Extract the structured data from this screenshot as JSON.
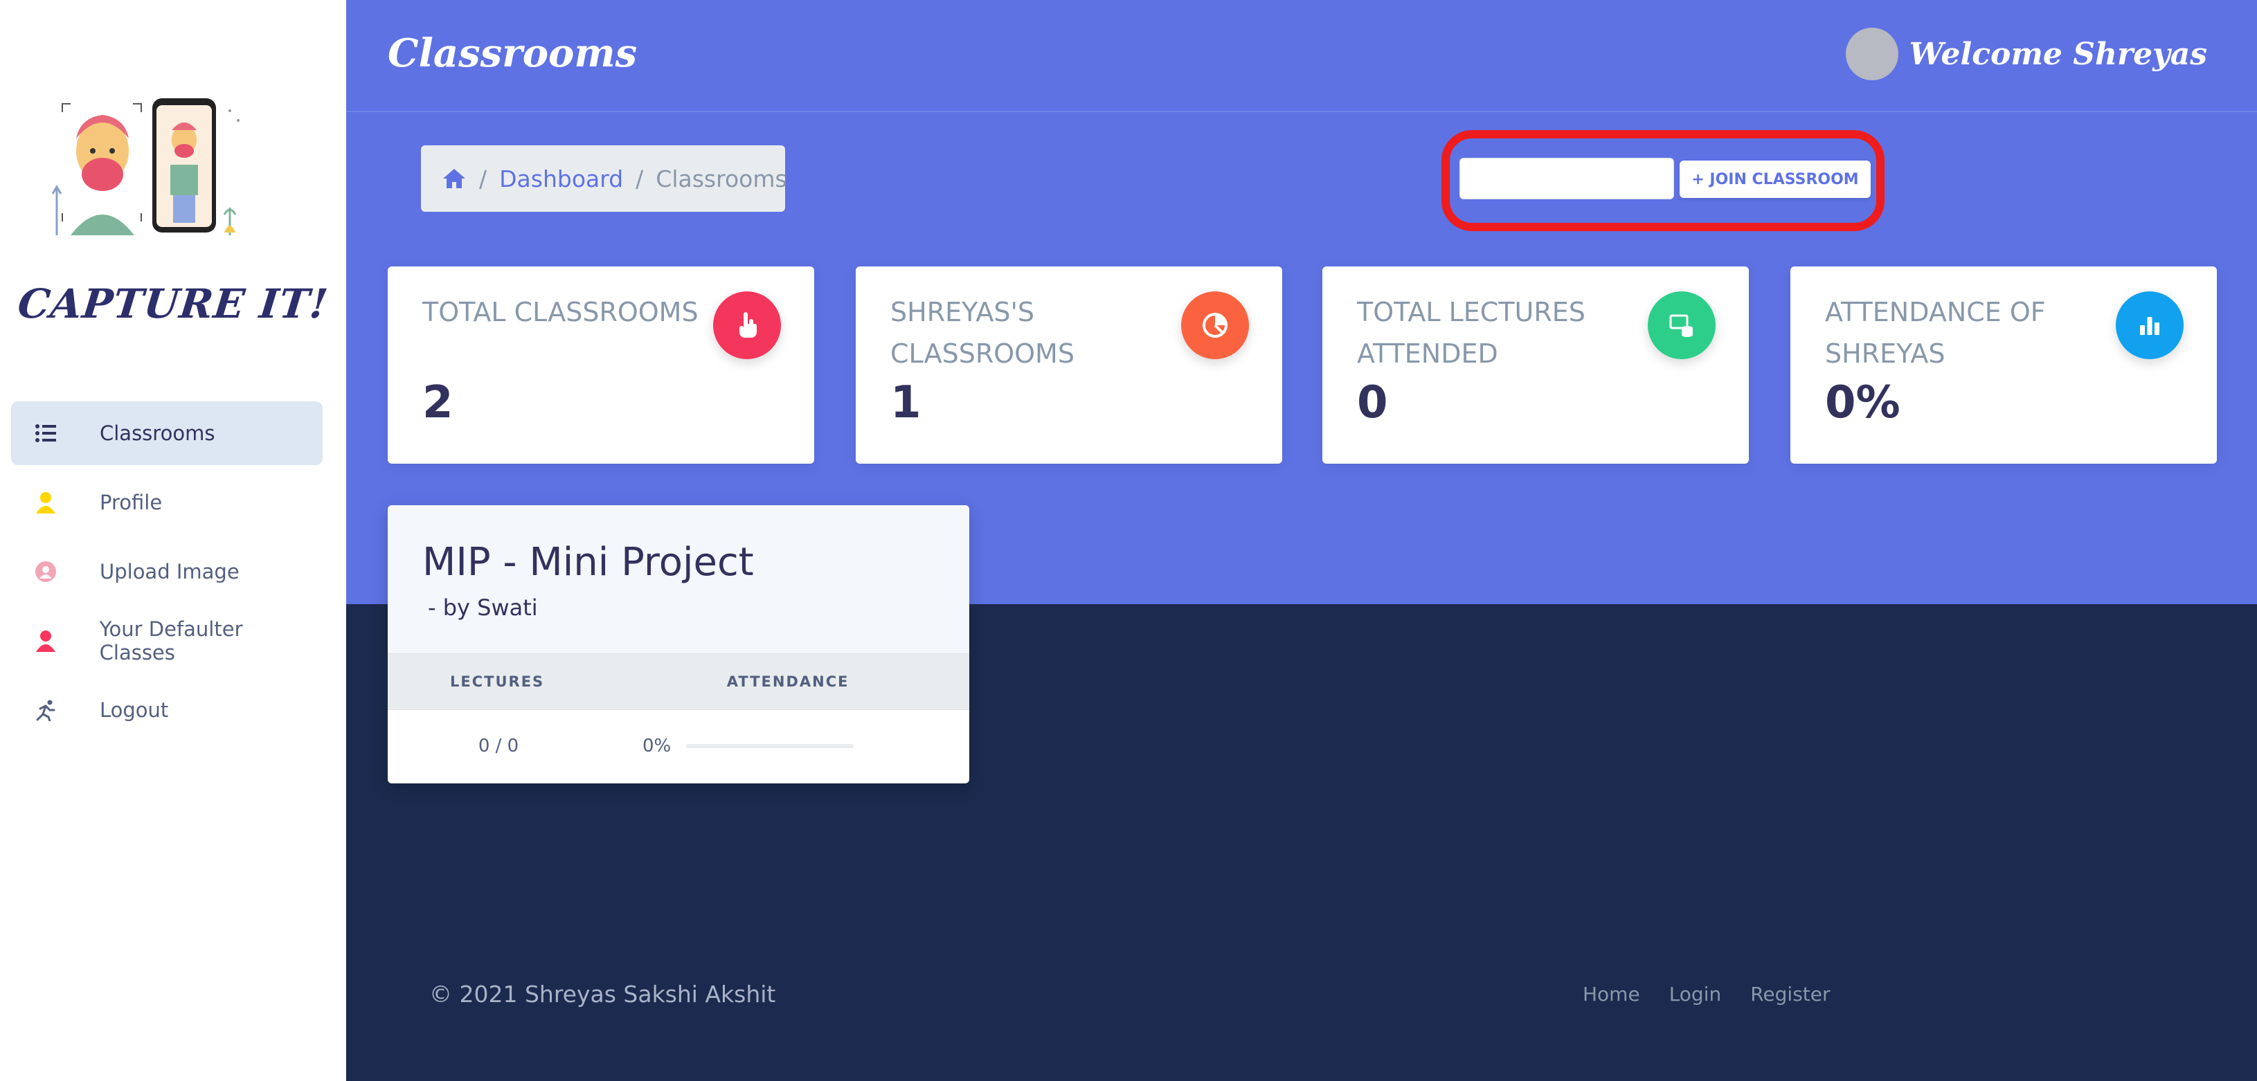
{
  "sidebar": {
    "brand": "CAPTURE IT!",
    "items": [
      {
        "label": "Classrooms",
        "icon": "list-icon",
        "active": true
      },
      {
        "label": "Profile",
        "icon": "user-icon"
      },
      {
        "label": "Upload Image",
        "icon": "user-circle-icon"
      },
      {
        "label": "Your Defaulter Classes",
        "icon": "user-icon"
      },
      {
        "label": "Logout",
        "icon": "running-icon"
      }
    ]
  },
  "header": {
    "title": "Classrooms",
    "welcome": "Welcome Shreyas"
  },
  "breadcrumb": {
    "home_icon": "home-icon",
    "items": [
      "Dashboard",
      "Classrooms"
    ]
  },
  "join": {
    "input_value": "",
    "button_label": "+ JOIN CLASSROOM"
  },
  "stats": [
    {
      "title": "TOTAL CLASSROOMS",
      "value": "2",
      "icon": "pointer-hand-icon",
      "color": "#f5365c"
    },
    {
      "title": "SHREYAS'S CLASSROOMS",
      "value": "1",
      "icon": "pie-chart-icon",
      "color": "#fb6340"
    },
    {
      "title": "TOTAL LECTURES ATTENDED",
      "value": "0",
      "icon": "database-icon",
      "color": "#2dce89"
    },
    {
      "title": "ATTENDANCE OF SHREYAS",
      "value": "0%",
      "icon": "bar-chart-icon",
      "color": "#11cdef"
    }
  ],
  "classroom": {
    "title": "MIP - Mini Project",
    "owner": "- by Swati",
    "columns": [
      "LECTURES",
      "ATTENDANCE"
    ],
    "lectures": "0 / 0",
    "attendance_label": "0%",
    "attendance_fraction": 0
  },
  "footer": {
    "copyright": "© 2021 Shreyas Sakshi Akshit",
    "links": [
      "Home",
      "Login",
      "Register"
    ]
  }
}
